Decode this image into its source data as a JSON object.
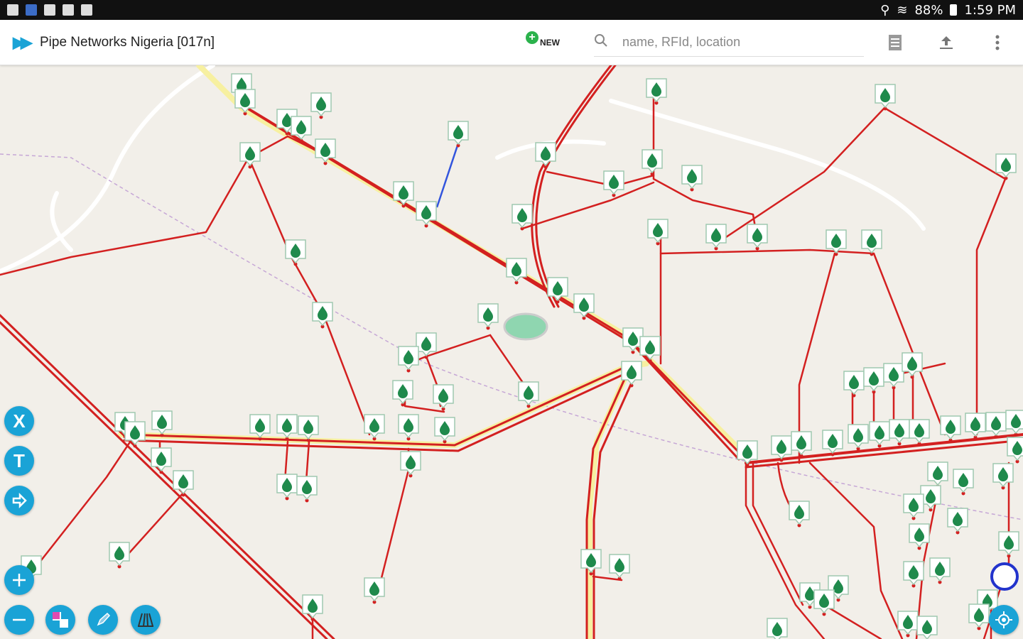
{
  "statusbar": {
    "battery": "88%",
    "time": "1:59 PM"
  },
  "app": {
    "title": "Pipe Networks Nigeria [017n]",
    "new_label": "NEW",
    "search_placeholder": "name, RFId, location"
  },
  "icons": {
    "app_logo": "double-chevron-right-icon",
    "new": "add-circle-icon",
    "search": "search-icon",
    "layers": "document-list-icon",
    "upload": "upload-icon",
    "menu": "more-vert-icon"
  },
  "side_tools": {
    "x_label": "X",
    "t_label": "T",
    "arrow_icon": "arrow-right-icon"
  },
  "bottom_tools": {
    "zoom_in_icon": "plus-icon",
    "zoom_out_icon": "minus-icon",
    "grid_icon": "grid-select-icon",
    "draw_icon": "pen-icon",
    "measure_icon": "measure-icon",
    "locate_icon": "my-location-icon"
  },
  "colors": {
    "pipe": "#d32020",
    "marker": "#1f8a4c",
    "accent": "#1aa3d6",
    "map_bg": "#f2efe9"
  }
}
